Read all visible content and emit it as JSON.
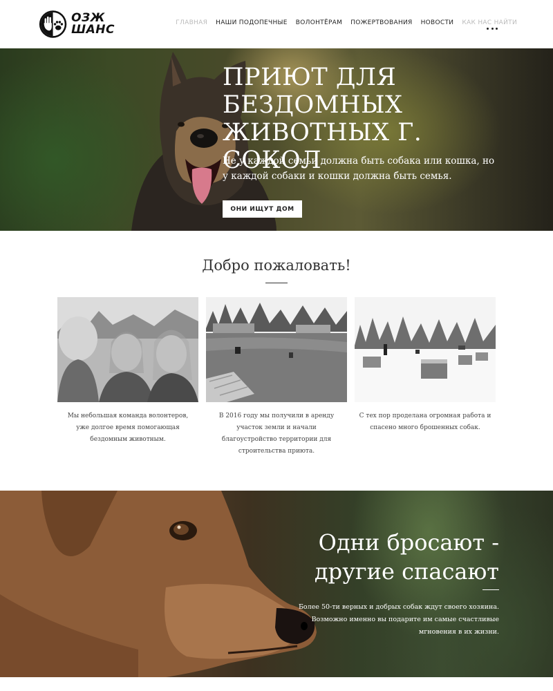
{
  "logo": {
    "line1": "ОЗЖ",
    "line2": "ШАНС"
  },
  "nav": {
    "items": [
      {
        "label": "ГЛАВНАЯ"
      },
      {
        "label": "НАШИ ПОДОПЕЧНЫЕ"
      },
      {
        "label": "ВОЛОНТЁРАМ"
      },
      {
        "label": "ПОЖЕРТВОВАНИЯ"
      },
      {
        "label": "НОВОСТИ"
      },
      {
        "label": "КАК НАС НАЙТИ"
      }
    ]
  },
  "hero": {
    "title": "ПРИЮТ ДЛЯ БЕЗДОМНЫХ ЖИВОТНЫХ Г. СОКОЛ",
    "subtitle": "Не у каждой семьи должна быть собака или кошка, но у каждой собаки и кошки должна быть семья.",
    "button": "ОНИ ИЩУТ ДОМ"
  },
  "welcome": {
    "title": "Добро пожаловать!",
    "cards": [
      {
        "text": "Мы небольшая команда волонтеров, уже долгое время помогающая бездомным животным."
      },
      {
        "text": "В 2016 году мы получили в аренду участок земли и начали благоустройство территории для строительства приюта."
      },
      {
        "text": "С тех пор проделана огромная работа и спасено много брошенных собак."
      }
    ]
  },
  "rescue": {
    "title": "Одни бросают - другие спасают",
    "text": "Более 50-ти верных и добрых собак ждут своего хозяина. Возможно именно вы подарите им самые счастливые мгновения в их жизни."
  }
}
